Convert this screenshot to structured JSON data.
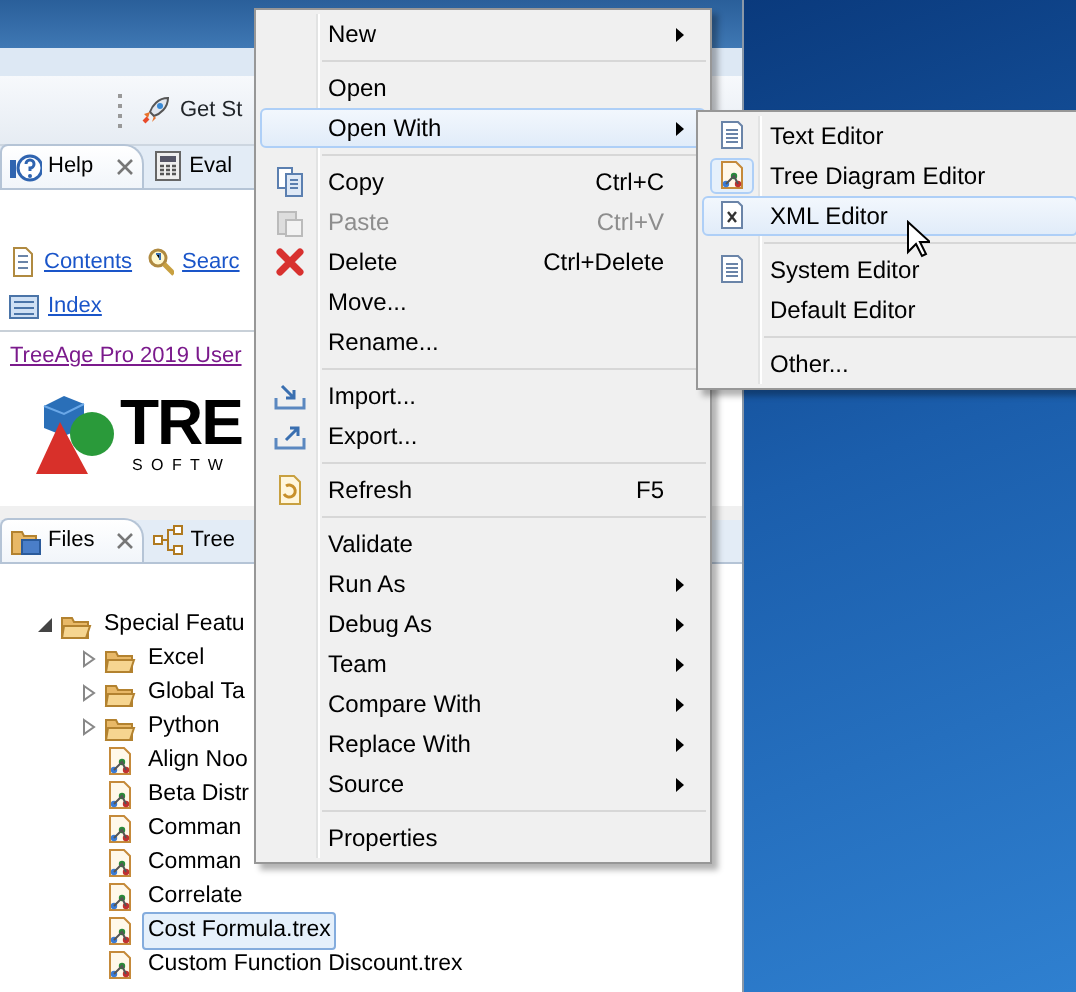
{
  "toolbar": {
    "button": "Get St"
  },
  "help_view": {
    "tabs": [
      {
        "label": "Help",
        "selected": true,
        "closable": true
      },
      {
        "label": "Eval",
        "selected": false,
        "closable": false
      }
    ],
    "links": [
      "Contents",
      "Searc"
    ],
    "index": "Index",
    "guide_link": "TreeAge Pro 2019 User",
    "logo": {
      "wordmark": "TRE",
      "tagline": "S O F T W"
    }
  },
  "files_view": {
    "tabs": [
      {
        "label": "Files",
        "selected": true,
        "closable": true
      },
      {
        "label": "Tree",
        "selected": false,
        "closable": false
      }
    ],
    "tree": [
      {
        "label": "Special Featu",
        "kind": "folder",
        "expanded": true,
        "selected": false,
        "children": [
          {
            "label": "Excel",
            "kind": "folder",
            "expanded": false,
            "selected": false
          },
          {
            "label": "Global Ta",
            "kind": "folder",
            "expanded": false,
            "selected": false
          },
          {
            "label": "Python",
            "kind": "folder",
            "expanded": false,
            "selected": false
          },
          {
            "label": "Align Noo",
            "kind": "file",
            "selected": false
          },
          {
            "label": "Beta Distr",
            "kind": "file",
            "selected": false
          },
          {
            "label": "Comman",
            "kind": "file",
            "selected": false
          },
          {
            "label": "Comman",
            "kind": "file",
            "selected": false
          },
          {
            "label": "Correlate",
            "kind": "file",
            "selected": false
          },
          {
            "label": "Cost Formula.trex",
            "kind": "file",
            "selected": true
          },
          {
            "label": "Custom Function Discount.trex",
            "kind": "file",
            "selected": false
          }
        ]
      }
    ]
  },
  "context_menu": {
    "items": [
      {
        "kind": "item",
        "label": "New",
        "submenu": true,
        "disabled": false,
        "selected": false
      },
      {
        "kind": "separator"
      },
      {
        "kind": "item",
        "label": "Open",
        "submenu": false,
        "disabled": false,
        "selected": false
      },
      {
        "kind": "item",
        "label": "Open With",
        "submenu": true,
        "disabled": false,
        "selected": true
      },
      {
        "kind": "separator"
      },
      {
        "kind": "item",
        "label": "Copy",
        "shortcut": "Ctrl+C",
        "submenu": false,
        "disabled": false,
        "selected": false
      },
      {
        "kind": "item",
        "label": "Paste",
        "shortcut": "Ctrl+V",
        "submenu": false,
        "disabled": true,
        "selected": false
      },
      {
        "kind": "item",
        "label": "Delete",
        "shortcut": "Ctrl+Delete",
        "submenu": false,
        "disabled": false,
        "selected": false
      },
      {
        "kind": "item",
        "label": "Move...",
        "submenu": false,
        "disabled": false,
        "selected": false
      },
      {
        "kind": "item",
        "label": "Rename...",
        "submenu": false,
        "disabled": false,
        "selected": false
      },
      {
        "kind": "separator"
      },
      {
        "kind": "item",
        "label": "Import...",
        "submenu": false,
        "disabled": false,
        "selected": false
      },
      {
        "kind": "item",
        "label": "Export...",
        "submenu": false,
        "disabled": false,
        "selected": false
      },
      {
        "kind": "separator"
      },
      {
        "kind": "item",
        "label": "Refresh",
        "shortcut": "F5",
        "submenu": false,
        "disabled": false,
        "selected": false
      },
      {
        "kind": "separator"
      },
      {
        "kind": "item",
        "label": "Validate",
        "submenu": false,
        "disabled": false,
        "selected": false
      },
      {
        "kind": "item",
        "label": "Run As",
        "submenu": true,
        "disabled": false,
        "selected": false
      },
      {
        "kind": "item",
        "label": "Debug As",
        "submenu": true,
        "disabled": false,
        "selected": false
      },
      {
        "kind": "item",
        "label": "Team",
        "submenu": true,
        "disabled": false,
        "selected": false
      },
      {
        "kind": "item",
        "label": "Compare With",
        "submenu": true,
        "disabled": false,
        "selected": false
      },
      {
        "kind": "item",
        "label": "Replace With",
        "submenu": true,
        "disabled": false,
        "selected": false
      },
      {
        "kind": "item",
        "label": "Source",
        "submenu": true,
        "disabled": false,
        "selected": false
      },
      {
        "kind": "separator"
      },
      {
        "kind": "item",
        "label": "Properties",
        "submenu": false,
        "disabled": false,
        "selected": false
      }
    ]
  },
  "open_with_menu": {
    "items": [
      {
        "kind": "item",
        "label": "Text Editor",
        "checked": false,
        "selected": false
      },
      {
        "kind": "item",
        "label": "Tree Diagram Editor",
        "checked": true,
        "selected": false
      },
      {
        "kind": "item",
        "label": "XML Editor",
        "checked": false,
        "selected": true
      },
      {
        "kind": "separator"
      },
      {
        "kind": "item",
        "label": "System Editor",
        "checked": false,
        "selected": false
      },
      {
        "kind": "item",
        "label": "Default Editor",
        "checked": false,
        "selected": false
      },
      {
        "kind": "separator"
      },
      {
        "kind": "item",
        "label": "Other...",
        "checked": false,
        "selected": false
      }
    ]
  }
}
